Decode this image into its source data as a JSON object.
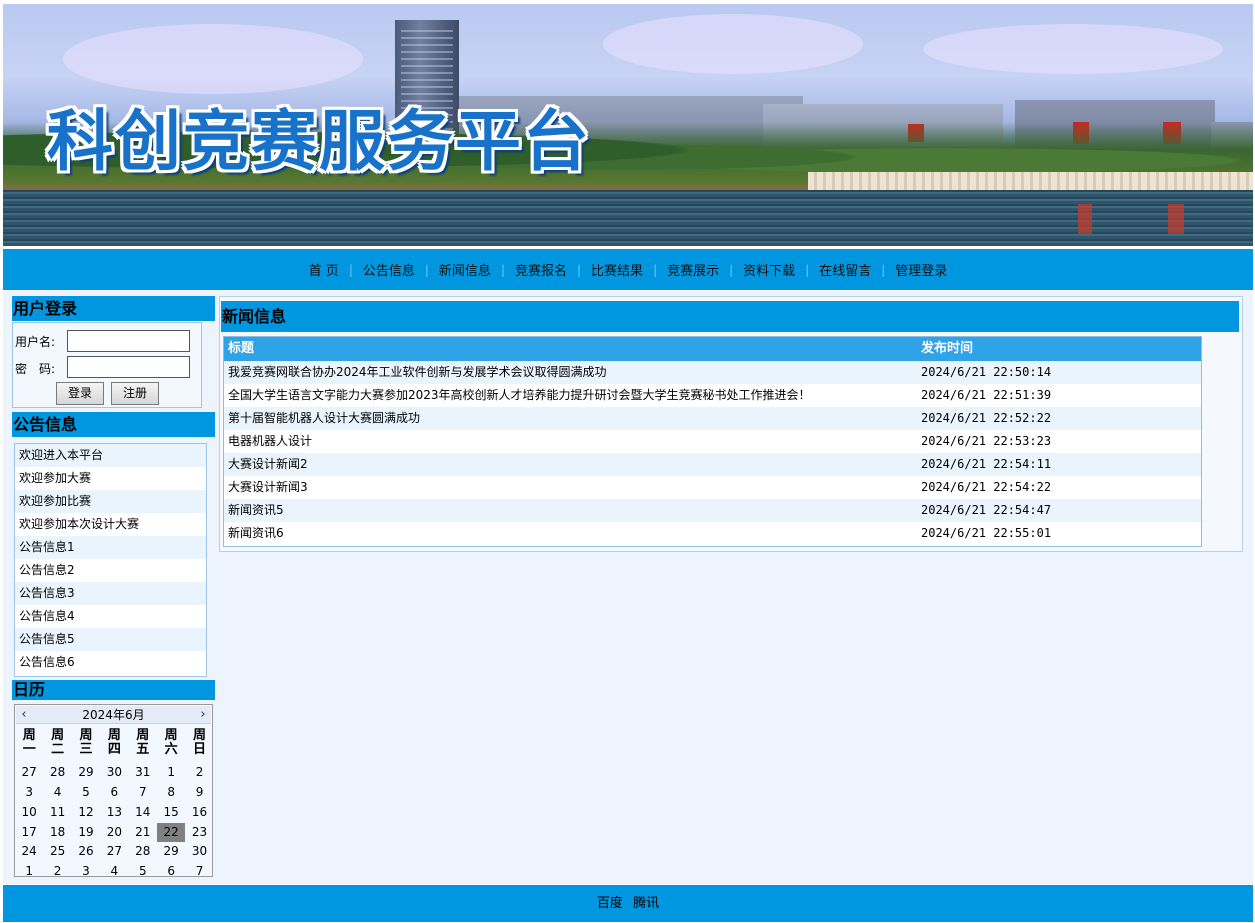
{
  "banner": {
    "title": "科创竞赛服务平台"
  },
  "nav": [
    "首 页",
    "公告信息",
    "新闻信息",
    "竞赛报名",
    "比赛结果",
    "竞赛展示",
    "资料下载",
    "在线留言",
    "管理登录"
  ],
  "login": {
    "title": "用户登录",
    "username_label": "用户名:",
    "password_label": "密　码:",
    "username_value": "",
    "password_value": "",
    "login_button": "登录",
    "register_button": "注册"
  },
  "notices": {
    "title": "公告信息",
    "items": [
      "欢迎进入本平台",
      "欢迎参加大赛",
      "欢迎参加比赛",
      "欢迎参加本次设计大赛",
      "公告信息1",
      "公告信息2",
      "公告信息3",
      "公告信息4",
      "公告信息5",
      "公告信息6"
    ]
  },
  "calendar": {
    "title": "日历",
    "month_label": "2024年6月",
    "prev": "‹",
    "next": "›",
    "weekdays": [
      "周一",
      "周二",
      "周三",
      "周四",
      "周五",
      "周六",
      "周日"
    ],
    "weeks": [
      [
        "27",
        "28",
        "29",
        "30",
        "31",
        "1",
        "2"
      ],
      [
        "3",
        "4",
        "5",
        "6",
        "7",
        "8",
        "9"
      ],
      [
        "10",
        "11",
        "12",
        "13",
        "14",
        "15",
        "16"
      ],
      [
        "17",
        "18",
        "19",
        "20",
        "21",
        "22",
        "23"
      ],
      [
        "24",
        "25",
        "26",
        "27",
        "28",
        "29",
        "30"
      ],
      [
        "1",
        "2",
        "3",
        "4",
        "5",
        "6",
        "7"
      ]
    ],
    "today": "22"
  },
  "news": {
    "title": "新闻信息",
    "col_title": "标题",
    "col_time": "发布时间",
    "rows": [
      {
        "title": "我爱竞赛网联合协办2024年工业软件创新与发展学术会议取得圆满成功",
        "time": "2024/6/21 22:50:14"
      },
      {
        "title": "全国大学生语言文字能力大赛参加2023年高校创新人才培养能力提升研讨会暨大学生竞赛秘书处工作推进会！",
        "time": "2024/6/21 22:51:39"
      },
      {
        "title": "第十届智能机器人设计大赛圆满成功",
        "time": "2024/6/21 22:52:22"
      },
      {
        "title": "电器机器人设计",
        "time": "2024/6/21 22:53:23"
      },
      {
        "title": "大赛设计新闻2",
        "time": "2024/6/21 22:54:11"
      },
      {
        "title": "大赛设计新闻3",
        "time": "2024/6/21 22:54:22"
      },
      {
        "title": "新闻资讯5",
        "time": "2024/6/21 22:54:47"
      },
      {
        "title": "新闻资讯6",
        "time": "2024/6/21 22:55:01"
      }
    ]
  },
  "footer": {
    "links": [
      "百度",
      "腾讯"
    ]
  }
}
